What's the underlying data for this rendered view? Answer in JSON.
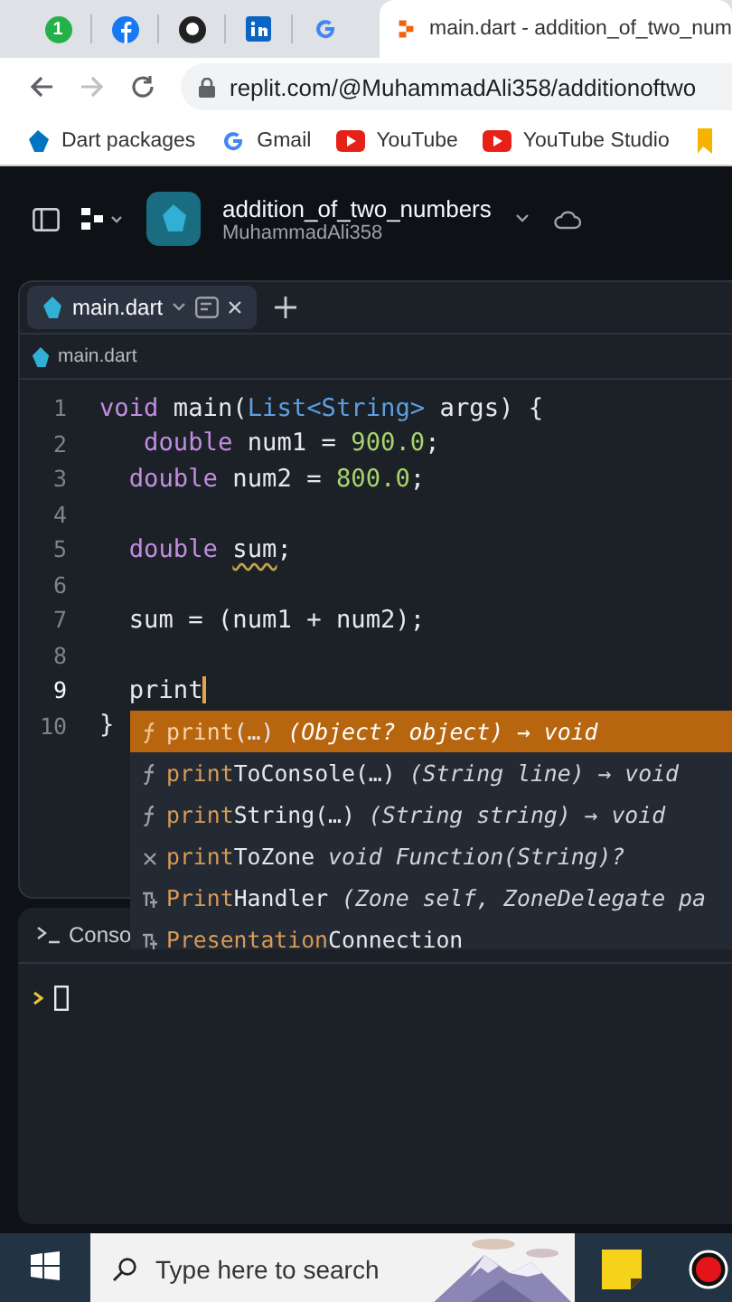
{
  "browser": {
    "pinned_badge": "1",
    "active_tab": {
      "title": "main.dart - addition_of_two_num"
    },
    "address": "replit.com/@MuhammadAli358/additionoftwo",
    "bookmarks": [
      {
        "label": "Dart packages",
        "kind": "dart"
      },
      {
        "label": "Gmail",
        "kind": "google"
      },
      {
        "label": "YouTube",
        "kind": "youtube"
      },
      {
        "label": "YouTube Studio",
        "kind": "youtube"
      }
    ]
  },
  "project": {
    "title": "addition_of_two_numbers",
    "owner": "MuhammadAli358"
  },
  "editor": {
    "tabs": [
      {
        "label": "main.dart",
        "selected": true
      }
    ],
    "breadcrumb": "main.dart",
    "lines": [
      {
        "number": "1",
        "current": false,
        "tokens": [
          {
            "text": "void",
            "kind": "keyword"
          },
          {
            "text": " main(",
            "kind": "plain"
          },
          {
            "text": "List<String>",
            "kind": "type"
          },
          {
            "text": " args) {",
            "kind": "plain"
          }
        ]
      },
      {
        "number": "2",
        "current": false,
        "tokens": [
          {
            "text": "   double",
            "kind": "keyword"
          },
          {
            "text": " num1 = ",
            "kind": "plain"
          },
          {
            "text": "900.0",
            "kind": "number"
          },
          {
            "text": ";",
            "kind": "plain"
          }
        ]
      },
      {
        "number": "3",
        "current": false,
        "tokens": [
          {
            "text": "  double",
            "kind": "keyword"
          },
          {
            "text": " num2 = ",
            "kind": "plain"
          },
          {
            "text": "800.0",
            "kind": "number"
          },
          {
            "text": ";",
            "kind": "plain"
          }
        ]
      },
      {
        "number": "4",
        "current": false
      },
      {
        "number": "5",
        "current": false,
        "tokens": [
          {
            "text": "  double ",
            "kind": "keyword"
          },
          {
            "text": "sum",
            "kind": "plain",
            "warning": true
          },
          {
            "text": ";",
            "kind": "plain"
          }
        ]
      },
      {
        "number": "6",
        "current": false
      },
      {
        "number": "7",
        "current": false,
        "tokens": [
          {
            "text": "  sum = (num1 + num2);",
            "kind": "plain"
          }
        ]
      },
      {
        "number": "8",
        "current": false
      },
      {
        "number": "9",
        "tokens": [
          {
            "text": "  print",
            "kind": "plain"
          }
        ],
        "current": true,
        "cursor": true
      },
      {
        "number": "10",
        "current": false,
        "tokens": [
          {
            "text": "}",
            "kind": "plain"
          }
        ]
      }
    ],
    "completions": [
      {
        "kind": "function",
        "match": "print",
        "rest": "(…)",
        "detail": "(Object? object) → void",
        "selected": true
      },
      {
        "kind": "function",
        "match": "print",
        "rest": "ToConsole(…)",
        "detail": "(String line) → void",
        "selected": false
      },
      {
        "kind": "function",
        "match": "print",
        "rest": "String(…)",
        "detail": "(String string) → void",
        "selected": false
      },
      {
        "kind": "variable",
        "match": "print",
        "rest": "ToZone",
        "detail": "void Function(String)?",
        "selected": false
      },
      {
        "kind": "typedef",
        "match": "Print",
        "rest": "Handler",
        "detail": "(Zone self, ZoneDelegate pa",
        "selected": false
      },
      {
        "kind": "typedef",
        "match": "Presentation",
        "rest": "Connection",
        "selected": false
      }
    ]
  },
  "console": {
    "tab": "Conso"
  },
  "taskbar": {
    "search_placeholder": "Type here to search"
  }
}
